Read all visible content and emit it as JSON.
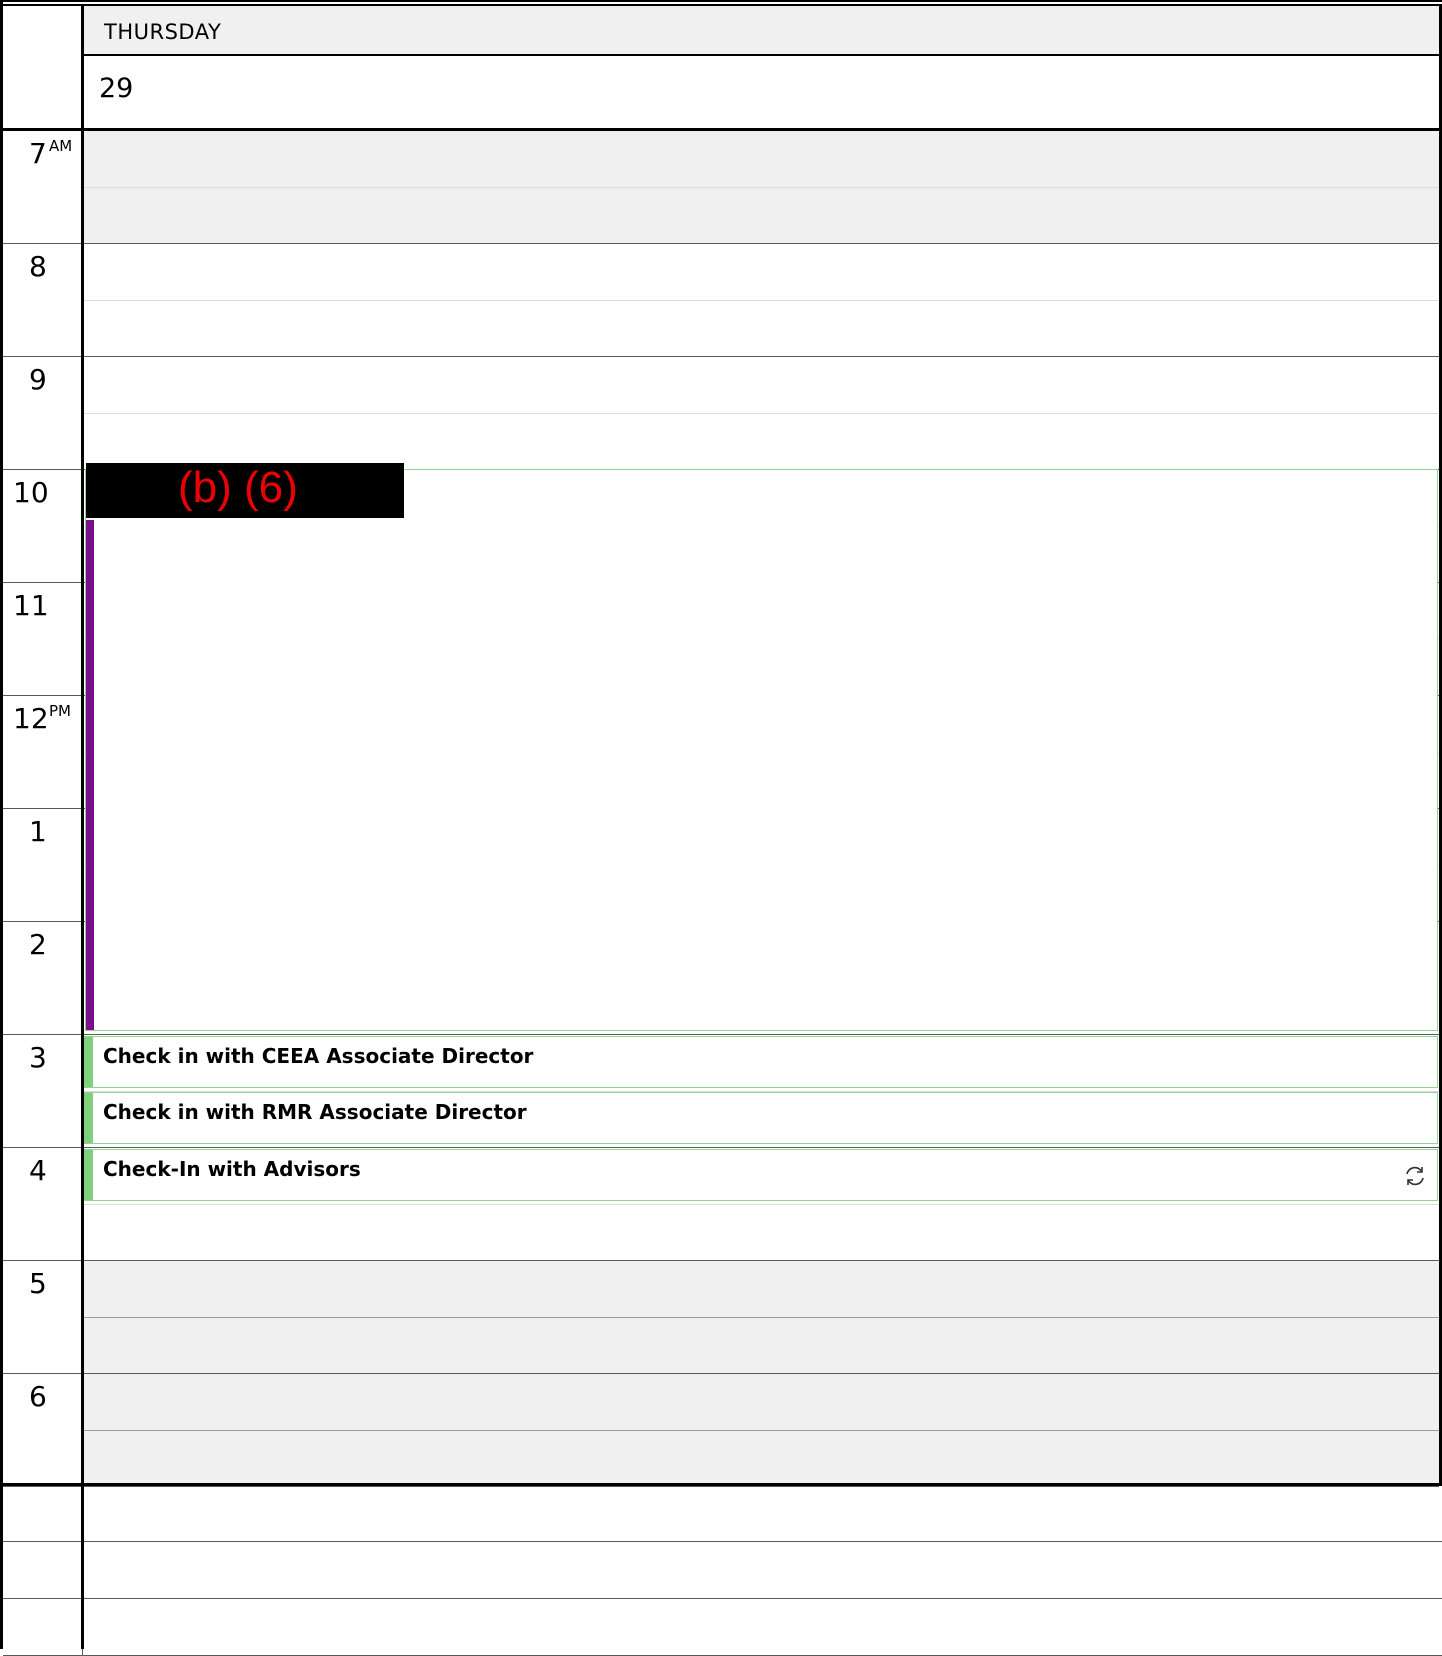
{
  "day": {
    "name": "THURSDAY",
    "number": "29"
  },
  "hours": [
    {
      "label": "7",
      "period": "AM"
    },
    {
      "label": "8",
      "period": ""
    },
    {
      "label": "9",
      "period": ""
    },
    {
      "label": "10",
      "period": ""
    },
    {
      "label": "11",
      "period": ""
    },
    {
      "label": "12",
      "period": "PM"
    },
    {
      "label": "1",
      "period": ""
    },
    {
      "label": "2",
      "period": ""
    },
    {
      "label": "3",
      "period": ""
    },
    {
      "label": "4",
      "period": ""
    },
    {
      "label": "5",
      "period": ""
    },
    {
      "label": "6",
      "period": ""
    }
  ],
  "redaction": {
    "label": "(b) (6)"
  },
  "events": [
    {
      "title": "Check in with CEEA Associate Director"
    },
    {
      "title": "Check in with RMR Associate Director"
    },
    {
      "title": "Check-In with Advisors",
      "icon": "recurring-sync-icon"
    }
  ],
  "colors": {
    "event_border": "#8fd48f",
    "event_accent": "#80d080",
    "purple_accent": "#7a0f8a",
    "shaded": "#f0f0f0",
    "redaction_text": "#ee0000"
  }
}
